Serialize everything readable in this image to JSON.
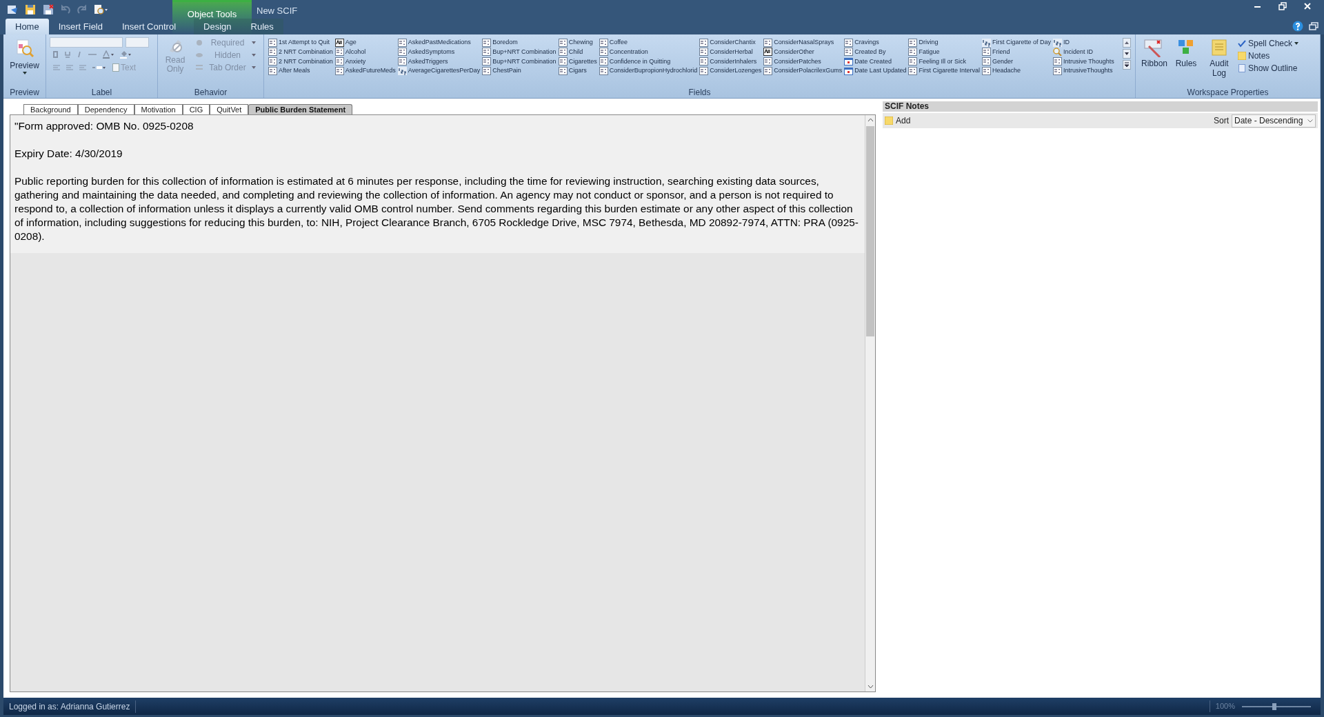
{
  "window": {
    "title": "New SCIF",
    "contextual_group": "Object Tools"
  },
  "ribbon_tabs": [
    {
      "label": "Home",
      "selected": true,
      "contextual": false
    },
    {
      "label": "Insert Field",
      "selected": false,
      "contextual": false
    },
    {
      "label": "Insert Control",
      "selected": false,
      "contextual": false
    },
    {
      "label": "Design",
      "selected": false,
      "contextual": true
    },
    {
      "label": "Rules",
      "selected": false,
      "contextual": true
    }
  ],
  "preview_group": {
    "label": "Preview",
    "button": "Preview"
  },
  "label_group": {
    "label": "Label",
    "text_button": {
      "label": "Text",
      "disabled": true
    }
  },
  "behavior_group": {
    "label": "Behavior",
    "read_only": {
      "label": "Read Only",
      "disabled": true
    },
    "items": [
      {
        "label": "Required",
        "disabled": true
      },
      {
        "label": "Hidden",
        "disabled": true
      },
      {
        "label": "Tab Order",
        "disabled": true
      }
    ]
  },
  "fields_group": {
    "label": "Fields",
    "items": [
      {
        "label": "1st Attempt to Quit",
        "kind": "list"
      },
      {
        "label": "2 NRT Combination",
        "kind": "list"
      },
      {
        "label": "2 NRT Combination",
        "kind": "list"
      },
      {
        "label": "After Meals",
        "kind": "list"
      },
      {
        "label": "Age",
        "kind": "text"
      },
      {
        "label": "Alcohol",
        "kind": "list"
      },
      {
        "label": "Anxiety",
        "kind": "list"
      },
      {
        "label": "AskedFutureMeds",
        "kind": "list"
      },
      {
        "label": "AskedPastMedications",
        "kind": "list"
      },
      {
        "label": "AskedSymptoms",
        "kind": "list"
      },
      {
        "label": "AskedTriggers",
        "kind": "list"
      },
      {
        "label": "AverageCigarettesPerDay",
        "kind": "number"
      },
      {
        "label": "Boredom",
        "kind": "list"
      },
      {
        "label": "Bup+NRT Combination",
        "kind": "list"
      },
      {
        "label": "Bup+NRT Combination",
        "kind": "list"
      },
      {
        "label": "ChestPain",
        "kind": "list"
      },
      {
        "label": "Chewing",
        "kind": "list"
      },
      {
        "label": "Child",
        "kind": "list"
      },
      {
        "label": "Cigarettes",
        "kind": "list"
      },
      {
        "label": "Cigars",
        "kind": "list"
      },
      {
        "label": "Coffee",
        "kind": "list"
      },
      {
        "label": "Concentration",
        "kind": "list"
      },
      {
        "label": "Confidence in Quitting",
        "kind": "list"
      },
      {
        "label": "ConsiderBupropionHydrochlorid",
        "kind": "list"
      },
      {
        "label": "ConsiderChantix",
        "kind": "list"
      },
      {
        "label": "ConsiderHerbal",
        "kind": "list"
      },
      {
        "label": "ConsiderInhalers",
        "kind": "list"
      },
      {
        "label": "ConsiderLozenges",
        "kind": "list"
      },
      {
        "label": "ConsiderNasalSprays",
        "kind": "list"
      },
      {
        "label": "ConsiderOther",
        "kind": "text"
      },
      {
        "label": "ConsiderPatches",
        "kind": "list"
      },
      {
        "label": "ConsiderPolacrilexGums",
        "kind": "list"
      },
      {
        "label": "Cravings",
        "kind": "list"
      },
      {
        "label": "Created By",
        "kind": "list"
      },
      {
        "label": "Date Created",
        "kind": "date"
      },
      {
        "label": "Date Last Updated",
        "kind": "date"
      },
      {
        "label": "Driving",
        "kind": "list"
      },
      {
        "label": "Fatigue",
        "kind": "list"
      },
      {
        "label": "Feeling Ill or Sick",
        "kind": "list"
      },
      {
        "label": "First Cigarette Interval",
        "kind": "list"
      },
      {
        "label": "First Cigarette of Day",
        "kind": "number"
      },
      {
        "label": "Friend",
        "kind": "list"
      },
      {
        "label": "Gender",
        "kind": "list"
      },
      {
        "label": "Headache",
        "kind": "list"
      },
      {
        "label": "ID",
        "kind": "number"
      },
      {
        "label": "Incident ID",
        "kind": "lookup"
      },
      {
        "label": "Intrusive Thoughts",
        "kind": "list"
      },
      {
        "label": "IntrusiveThoughts",
        "kind": "list"
      }
    ]
  },
  "workspace_group": {
    "label": "Workspace Properties",
    "large": [
      {
        "label": "Ribbon",
        "kind": "ribbon"
      },
      {
        "label": "Rules",
        "kind": "rules"
      },
      {
        "label": "Audit Log",
        "kind": "log"
      }
    ],
    "small": [
      {
        "label": "Spell Check",
        "kind": "spell"
      },
      {
        "label": "Notes",
        "kind": "notes"
      },
      {
        "label": "Show Outline",
        "kind": "outline"
      }
    ]
  },
  "document_tabs": [
    {
      "label": "Background",
      "selected": false
    },
    {
      "label": "Dependency",
      "selected": false
    },
    {
      "label": "Motivation",
      "selected": false
    },
    {
      "label": "CIG",
      "selected": false
    },
    {
      "label": "QuitVet",
      "selected": false
    },
    {
      "label": "Public Burden Statement",
      "selected": true
    }
  ],
  "content": [
    "\"Form approved: OMB No. 0925-0208",
    "Expiry Date:  4/30/2019",
    "Public reporting burden for this collection of information is estimated at 6 minutes per response, including the time for reviewing instruction, searching existing data sources, gathering and maintaining the data needed, and completing and reviewing the collection of information. An agency may not conduct or sponsor, and a person is not required to respond to, a collection of information unless it displays a currently valid OMB control number. Send comments regarding this burden estimate or any other aspect of this collection of information, including suggestions for reducing this burden, to: NIH, Project Clearance Branch, 6705 Rockledge Drive, MSC 7974, Bethesda, MD 20892-7974, ATTN: PRA (0925-0208)."
  ],
  "notes_panel": {
    "title": "SCIF Notes",
    "add": "Add",
    "sort_label": "Sort",
    "sort_value": "Date - Descending"
  },
  "status_bar": {
    "user": "Logged in as: Adrianna Gutierrez",
    "zoom": "100%",
    "level": 0.47
  }
}
